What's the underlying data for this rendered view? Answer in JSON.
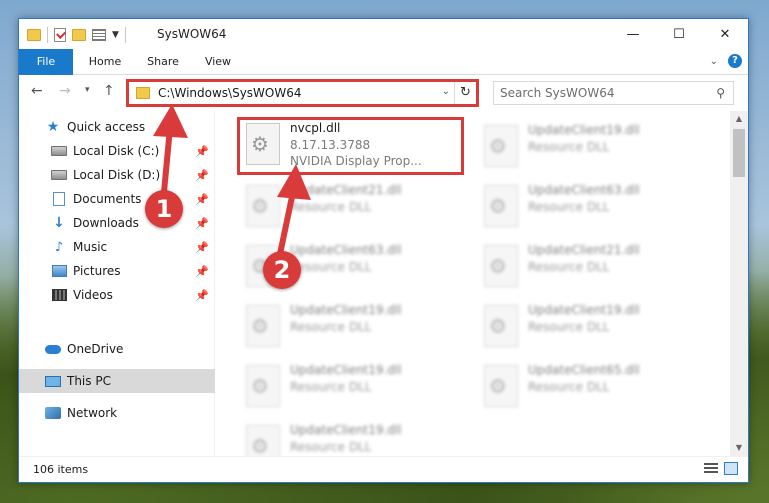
{
  "window": {
    "title": "SysWOW64",
    "minimize_glyph": "—",
    "maximize_glyph": "☐",
    "close_glyph": "✕"
  },
  "ribbon": {
    "tabs": [
      {
        "label": "File"
      },
      {
        "label": "Home"
      },
      {
        "label": "Share"
      },
      {
        "label": "View"
      }
    ]
  },
  "navigation": {
    "back_glyph": "←",
    "forward_glyph": "→",
    "recent_glyph": "▾",
    "up_glyph": "↑",
    "address": "C:\\Windows\\SysWOW64",
    "search_placeholder": "Search SysWOW64"
  },
  "sidebar": {
    "items": [
      {
        "label": "Quick access",
        "icon": "star-icon",
        "pinned": false
      },
      {
        "label": "Local Disk (C:)",
        "icon": "disk-icon",
        "pinned": true
      },
      {
        "label": "Local Disk (D:)",
        "icon": "disk-icon",
        "pinned": true
      },
      {
        "label": "Documents",
        "icon": "documents-icon",
        "pinned": true
      },
      {
        "label": "Downloads",
        "icon": "downloads-icon",
        "pinned": true
      },
      {
        "label": "Music",
        "icon": "music-icon",
        "pinned": true
      },
      {
        "label": "Pictures",
        "icon": "pictures-icon",
        "pinned": true
      },
      {
        "label": "Videos",
        "icon": "videos-icon",
        "pinned": true
      },
      {
        "label": "OneDrive",
        "icon": "onedrive-icon",
        "pinned": false
      },
      {
        "label": "This PC",
        "icon": "this-pc-icon",
        "pinned": false,
        "selected": true
      },
      {
        "label": "Network",
        "icon": "network-icon",
        "pinned": false
      }
    ]
  },
  "files": {
    "highlighted": {
      "name": "nvcpl.dll",
      "version": "8.17.13.3788",
      "description": "NVIDIA Display Prop..."
    },
    "column_left": [
      {
        "name": "UpdateClient21.dll",
        "type": "Resource DLL"
      },
      {
        "name": "UpdateClient63.dll",
        "type": "Resource DLL"
      },
      {
        "name": "UpdateClient19.dll",
        "type": "Resource DLL"
      },
      {
        "name": "UpdateClient19.dll",
        "type": "Resource DLL"
      },
      {
        "name": "UpdateClient19.dll",
        "type": "Resource DLL"
      }
    ],
    "column_right": [
      {
        "name": "UpdateClient19.dll",
        "type": "Resource DLL"
      },
      {
        "name": "UpdateClient63.dll",
        "type": "Resource DLL"
      },
      {
        "name": "UpdateClient21.dll",
        "type": "Resource DLL"
      },
      {
        "name": "UpdateClient19.dll",
        "type": "Resource DLL"
      },
      {
        "name": "UpdateClient65.dll",
        "type": "Resource DLL"
      }
    ]
  },
  "status": {
    "item_count": "106 items"
  },
  "annotations": {
    "step1": "1",
    "step2": "2",
    "accent": "#d93a3a"
  },
  "colors": {
    "file_tab": "#1979ca",
    "selection": "#d9d9d9"
  }
}
